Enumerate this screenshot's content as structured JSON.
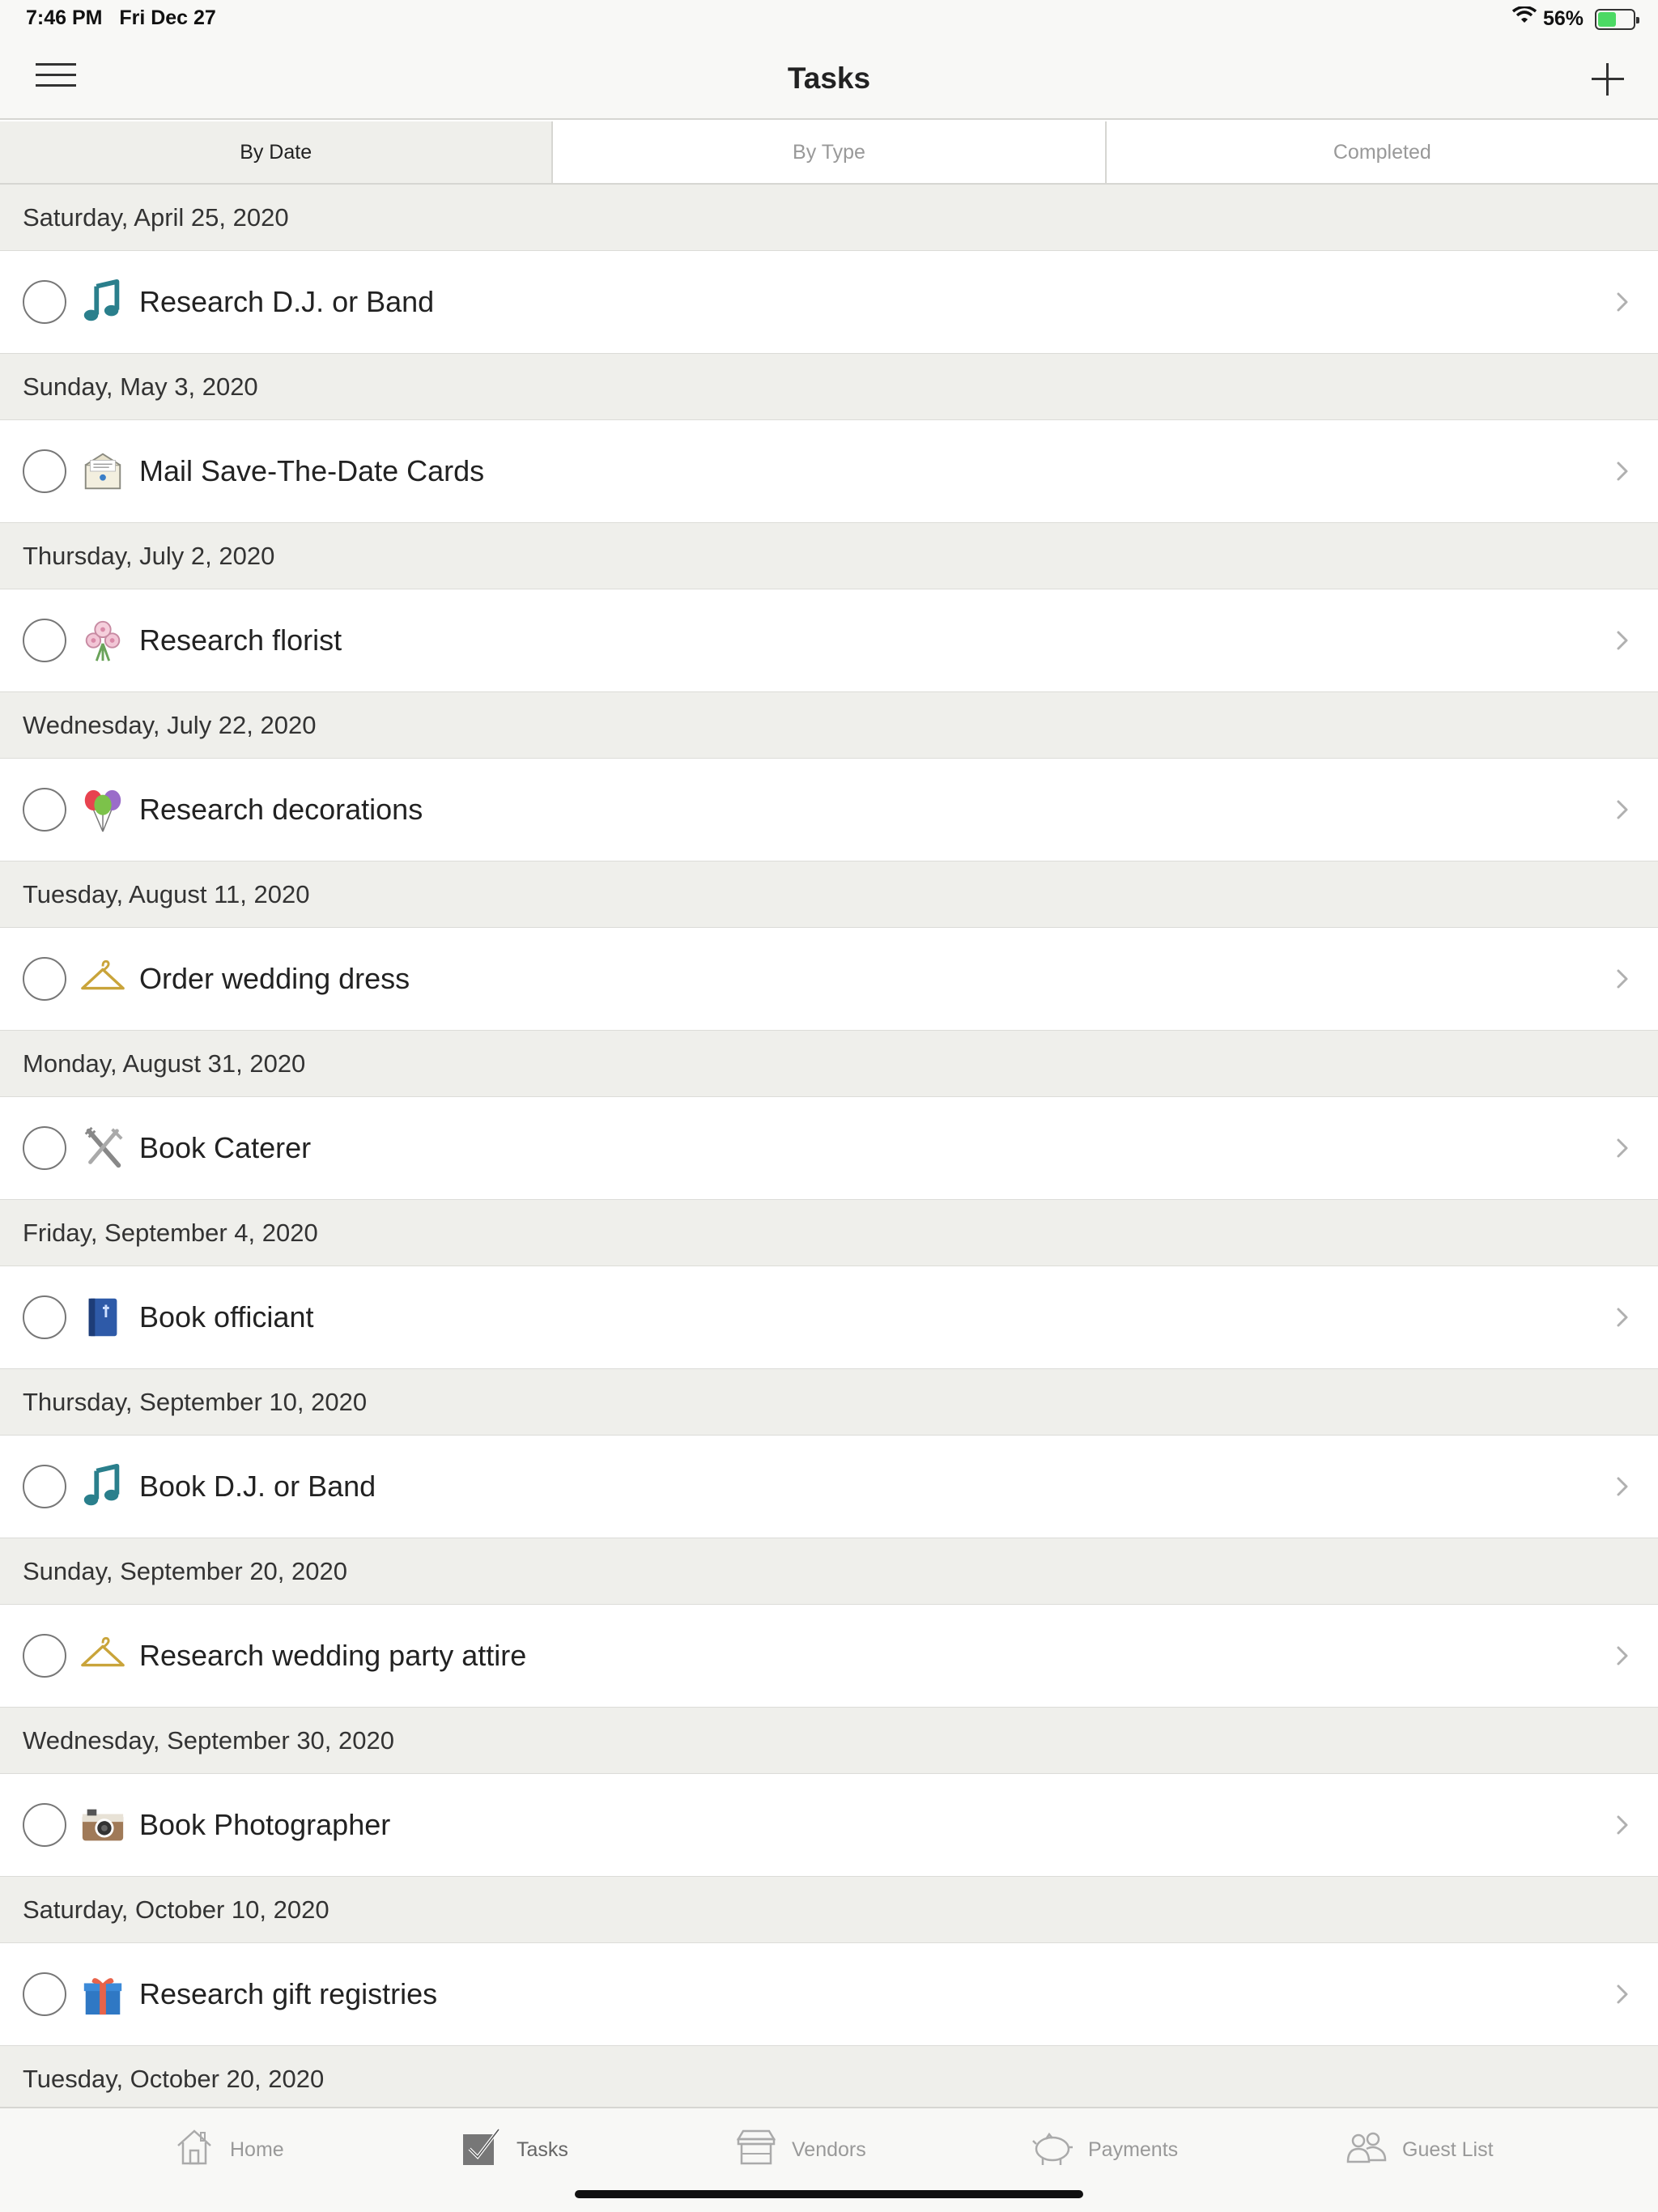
{
  "status": {
    "time": "7:46 PM",
    "date": "Fri Dec 27",
    "battery_text": "56%",
    "battery_level": 0.56
  },
  "nav": {
    "title": "Tasks"
  },
  "segments": [
    {
      "label": "By Date",
      "active": true
    },
    {
      "label": "By Type",
      "active": false
    },
    {
      "label": "Completed",
      "active": false
    }
  ],
  "sections": [
    {
      "date": "Saturday, April 25, 2020",
      "task": {
        "label": "Research D.J. or Band",
        "icon": "music-note-icon"
      }
    },
    {
      "date": "Sunday, May 3, 2020",
      "task": {
        "label": "Mail Save-The-Date Cards",
        "icon": "envelope-icon"
      }
    },
    {
      "date": "Thursday, July 2, 2020",
      "task": {
        "label": "Research florist",
        "icon": "flowers-icon"
      }
    },
    {
      "date": "Wednesday, July 22, 2020",
      "task": {
        "label": "Research decorations",
        "icon": "balloons-icon"
      }
    },
    {
      "date": "Tuesday, August 11, 2020",
      "task": {
        "label": "Order wedding dress",
        "icon": "hanger-icon"
      }
    },
    {
      "date": "Monday, August 31, 2020",
      "task": {
        "label": "Book Caterer",
        "icon": "utensils-icon"
      }
    },
    {
      "date": "Friday, September 4, 2020",
      "task": {
        "label": "Book officiant",
        "icon": "book-icon"
      }
    },
    {
      "date": "Thursday, September 10, 2020",
      "task": {
        "label": "Book D.J. or Band",
        "icon": "music-note-icon"
      }
    },
    {
      "date": "Sunday, September 20, 2020",
      "task": {
        "label": "Research wedding party attire",
        "icon": "hanger-icon"
      }
    },
    {
      "date": "Wednesday, September 30, 2020",
      "task": {
        "label": "Book Photographer",
        "icon": "camera-icon"
      }
    },
    {
      "date": "Saturday, October 10, 2020",
      "task": {
        "label": "Research gift registries",
        "icon": "gift-icon"
      }
    },
    {
      "date": "Tuesday, October 20, 2020"
    }
  ],
  "tabbar": [
    {
      "label": "Home",
      "icon": "home-icon",
      "active": false
    },
    {
      "label": "Tasks",
      "icon": "tasks-checkbox-icon",
      "active": true
    },
    {
      "label": "Vendors",
      "icon": "storefront-icon",
      "active": false
    },
    {
      "label": "Payments",
      "icon": "piggy-bank-icon",
      "active": false
    },
    {
      "label": "Guest List",
      "icon": "people-icon",
      "active": false
    }
  ]
}
